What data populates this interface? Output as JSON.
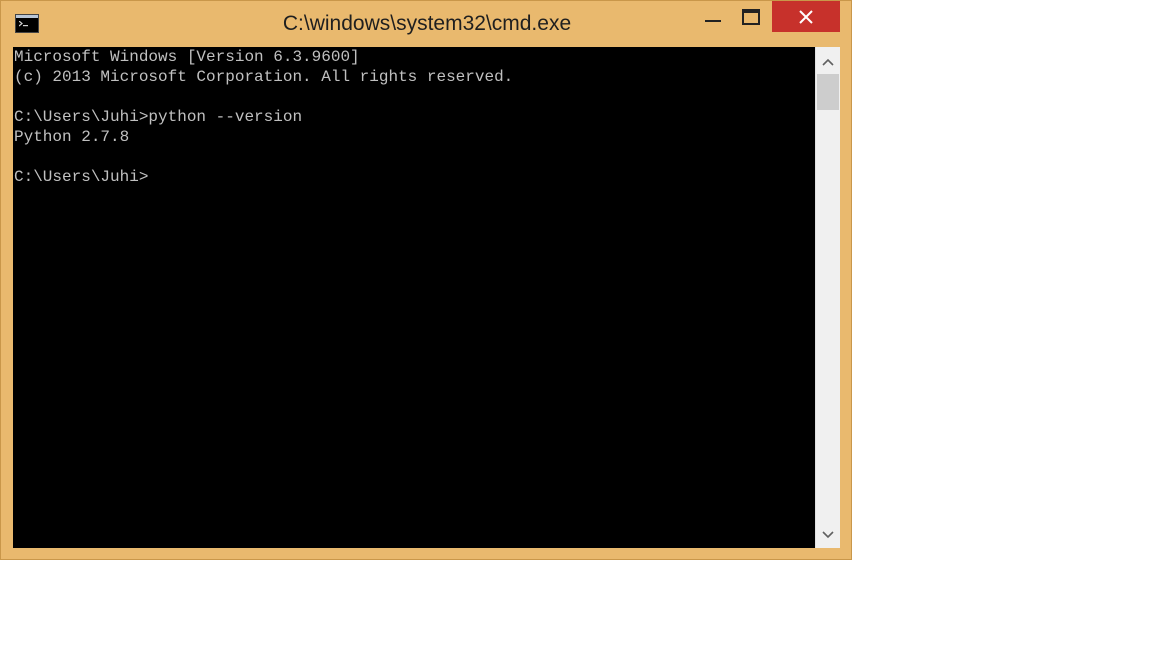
{
  "window": {
    "title": "C:\\windows\\system32\\cmd.exe",
    "accent": "#e9b96e",
    "close_color": "#c7312b"
  },
  "icons": {
    "app": "cmd-icon",
    "minimize": "minimize-icon",
    "maximize": "maximize-icon",
    "close": "close-icon",
    "scroll_up": "chevron-up-icon",
    "scroll_down": "chevron-down-icon"
  },
  "console": {
    "lines": [
      "Microsoft Windows [Version 6.3.9600]",
      "(c) 2013 Microsoft Corporation. All rights reserved.",
      "",
      "C:\\Users\\Juhi>python --version",
      "Python 2.7.8",
      "",
      "C:\\Users\\Juhi>"
    ]
  }
}
